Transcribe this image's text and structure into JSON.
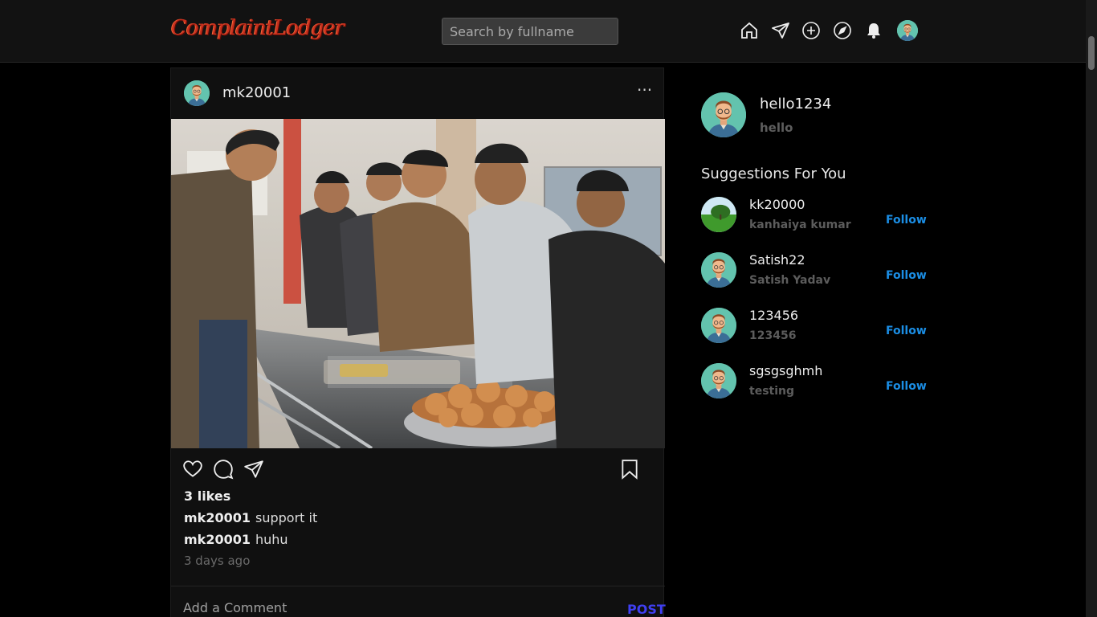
{
  "header": {
    "logo": "ComplaintLodger",
    "search_placeholder": "Search by fullname"
  },
  "nav": [
    "home-icon",
    "send-icon",
    "plus-circle-icon",
    "compass-icon",
    "bell-icon",
    "avatar"
  ],
  "post": {
    "username": "mk20001",
    "image_alt": "people at a mess food counter",
    "likes": "3 likes",
    "comments": [
      {
        "user": "mk20001",
        "text": "support it"
      },
      {
        "user": "mk20001",
        "text": "huhu"
      }
    ],
    "time": "3 days ago",
    "comment_placeholder": "Add a Comment",
    "post_button": "POST"
  },
  "profile": {
    "username": "hello1234",
    "fullname": "hello"
  },
  "suggestions": {
    "title": "Suggestions For You",
    "follow_label": "Follow",
    "items": [
      {
        "username": "kk20000",
        "fullname": "kanhaiya kumar",
        "avatar": "landscape"
      },
      {
        "username": "Satish22",
        "fullname": "Satish Yadav",
        "avatar": "default"
      },
      {
        "username": "123456",
        "fullname": "123456",
        "avatar": "default"
      },
      {
        "username": "sgsgsghmh",
        "fullname": "testing",
        "avatar": "default"
      }
    ]
  },
  "colors": {
    "background": "#000000",
    "header": "#121212",
    "card": "#101010",
    "follow": "#1b8ee5",
    "post_button": "#3f3ff2",
    "logo": "#c8301e"
  }
}
